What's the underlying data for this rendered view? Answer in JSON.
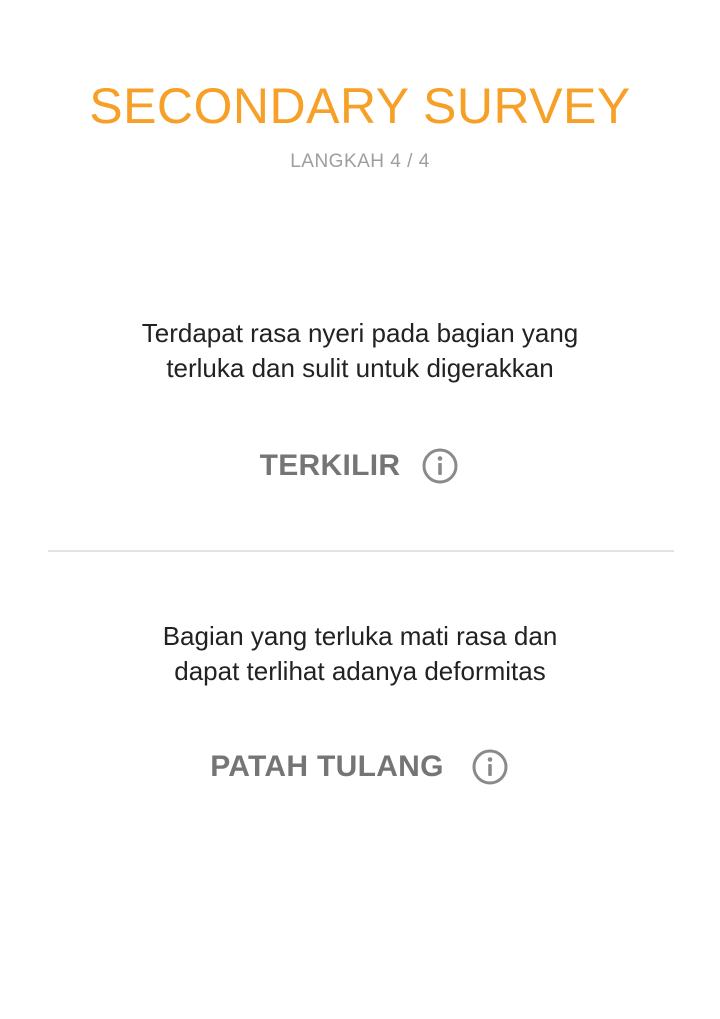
{
  "header": {
    "title": "SECONDARY SURVEY",
    "step": "LANGKAH 4 / 4"
  },
  "options": [
    {
      "description_line1": "Terdapat rasa nyeri pada bagian yang",
      "description_line2": "terluka dan sulit untuk digerakkan",
      "label": "TERKILIR",
      "icon": "info-icon"
    },
    {
      "description_line1": "Bagian yang terluka mati rasa dan",
      "description_line2": "dapat terlihat adanya deformitas",
      "label": "PATAH TULANG",
      "icon": "info-icon"
    }
  ],
  "colors": {
    "accent": "#F7A027",
    "option_text": "#757575",
    "muted": "#9e9e9e",
    "divider": "#e3e3e3"
  }
}
